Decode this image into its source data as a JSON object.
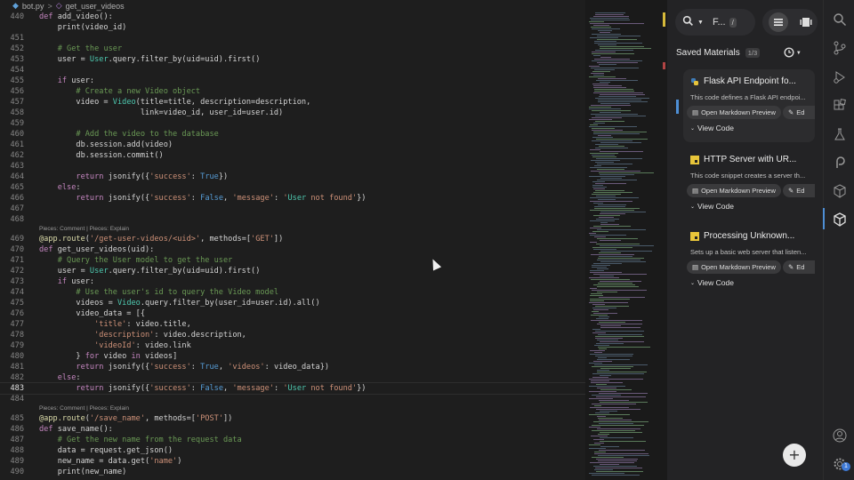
{
  "breadcrumb": {
    "file": "bot.py",
    "symbol": "get_user_videos",
    "separator": ">"
  },
  "editor": {
    "lines": [
      {
        "n": "440",
        "code": "def add_video():"
      },
      {
        "n": "",
        "code": "    print(video_id)"
      },
      {
        "n": "451",
        "code": ""
      },
      {
        "n": "452",
        "code": "    # Get the user"
      },
      {
        "n": "453",
        "code": "    user = User.query.filter_by(uid=uid).first()"
      },
      {
        "n": "454",
        "code": ""
      },
      {
        "n": "455",
        "code": "    if user:"
      },
      {
        "n": "456",
        "code": "        # Create a new Video object"
      },
      {
        "n": "457",
        "code": "        video = Video(title=title, description=description,"
      },
      {
        "n": "458",
        "code": "                      link=video_id, user_id=user.id)"
      },
      {
        "n": "459",
        "code": ""
      },
      {
        "n": "460",
        "code": "        # Add the video to the database"
      },
      {
        "n": "461",
        "code": "        db.session.add(video)"
      },
      {
        "n": "462",
        "code": "        db.session.commit()"
      },
      {
        "n": "463",
        "code": ""
      },
      {
        "n": "464",
        "code": "        return jsonify({'success': True})"
      },
      {
        "n": "465",
        "code": "    else:"
      },
      {
        "n": "466",
        "code": "        return jsonify({'success': False, 'message': 'User not found'})"
      },
      {
        "n": "467",
        "code": ""
      },
      {
        "n": "468",
        "code": ""
      },
      {
        "n": "",
        "code": "Pieces: Comment | Pieces: Explain",
        "lens": true
      },
      {
        "n": "469",
        "code": "@app.route('/get-user-videos/<uid>', methods=['GET'])"
      },
      {
        "n": "470",
        "code": "def get_user_videos(uid):"
      },
      {
        "n": "471",
        "code": "    # Query the User model to get the user"
      },
      {
        "n": "472",
        "code": "    user = User.query.filter_by(uid=uid).first()"
      },
      {
        "n": "473",
        "code": "    if user:"
      },
      {
        "n": "474",
        "code": "        # Use the user's id to query the Video model"
      },
      {
        "n": "475",
        "code": "        videos = Video.query.filter_by(user_id=user.id).all()"
      },
      {
        "n": "476",
        "code": "        video_data = [{"
      },
      {
        "n": "477",
        "code": "            'title': video.title,"
      },
      {
        "n": "478",
        "code": "            'description': video.description,"
      },
      {
        "n": "479",
        "code": "            'videoId': video.link"
      },
      {
        "n": "480",
        "code": "        } for video in videos]"
      },
      {
        "n": "481",
        "code": "        return jsonify({'success': True, 'videos': video_data})"
      },
      {
        "n": "482",
        "code": "    else:"
      },
      {
        "n": "483",
        "code": "        return jsonify({'success': False, 'message': 'User not found'})",
        "current": true
      },
      {
        "n": "484",
        "code": ""
      },
      {
        "n": "",
        "code": "Pieces: Comment | Pieces: Explain",
        "lens": true
      },
      {
        "n": "485",
        "code": "@app.route('/save_name', methods=['POST'])"
      },
      {
        "n": "486",
        "code": "def save_name():"
      },
      {
        "n": "487",
        "code": "    # Get the new name from the request data"
      },
      {
        "n": "488",
        "code": "    data = request.get_json()"
      },
      {
        "n": "489",
        "code": "    new_name = data.get('name')"
      },
      {
        "n": "490",
        "code": "    print(new_name)"
      }
    ]
  },
  "panel": {
    "search_value": "F...",
    "search_shortcut": "/",
    "section_title": "Saved Materials",
    "count": "1/3",
    "cards": [
      {
        "title": "Flask API Endpoint fo...",
        "description": "This code defines a Flask API endpoi...",
        "icon": "python-icon",
        "open_label": "Open Markdown Preview",
        "edit_label": "Ed",
        "code_label": "View Code",
        "active": true
      },
      {
        "title": "HTTP Server with UR...",
        "description": "This code snippet creates a server th...",
        "icon": "javascript-icon",
        "open_label": "Open Markdown Preview",
        "edit_label": "Ed",
        "code_label": "View Code",
        "active": false
      },
      {
        "title": "Processing Unknown...",
        "description": "Sets up a basic web server that listen...",
        "icon": "javascript-icon",
        "open_label": "Open Markdown Preview",
        "edit_label": "Ed",
        "code_label": "View Code",
        "active": false
      }
    ],
    "fab_label": "+"
  },
  "activity_badge": "1",
  "colors": {
    "accent": "#4e8fd6",
    "python_blue": "#3f7cb8",
    "js_yellow": "#e8c53a"
  }
}
